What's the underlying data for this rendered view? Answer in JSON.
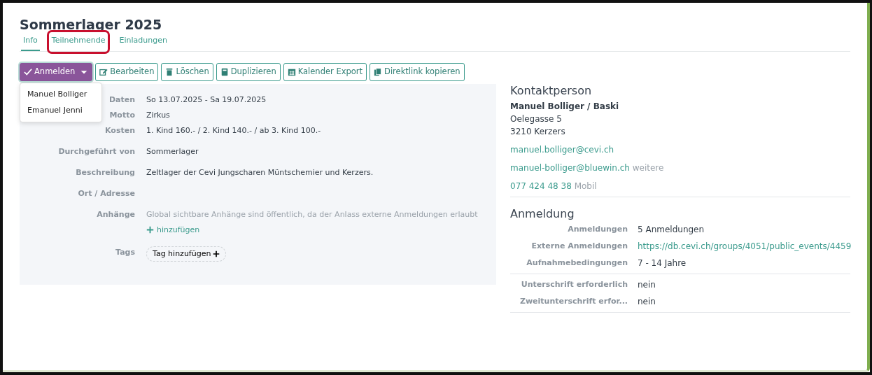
{
  "title": "Sommerlager 2025",
  "tabs": [
    {
      "label": "Info",
      "selected": true,
      "highlighted": false
    },
    {
      "label": "Teilnehmende",
      "selected": false,
      "highlighted": true
    },
    {
      "label": "Einladungen",
      "selected": false,
      "highlighted": false
    }
  ],
  "actions": [
    {
      "label": "Anmelden",
      "kind": "dropdown",
      "expanded": true,
      "menu": [
        "Manuel Bolliger",
        "Emanuel Jenni"
      ]
    },
    {
      "label": "Bearbeiten",
      "kind": "outline"
    },
    {
      "label": "Löschen",
      "kind": "outline"
    },
    {
      "label": "Duplizieren",
      "kind": "outline"
    },
    {
      "label": "Kalender Export",
      "kind": "outline"
    },
    {
      "label": "Direktlink kopieren",
      "kind": "outline"
    }
  ],
  "details": [
    {
      "label": "Daten",
      "kind": "text",
      "value": "So 13.07.2025 - Sa 19.07.2025"
    },
    {
      "label": "Motto",
      "kind": "text",
      "value": "Zirkus"
    },
    {
      "label": "Kosten",
      "kind": "text",
      "value": "1. Kind 160.- / 2. Kind 140.- / ab 3. Kind 100.-"
    },
    {
      "label": "Durchgeführt von",
      "kind": "text",
      "value": "Sommerlager"
    },
    {
      "label": "Beschreibung",
      "kind": "text",
      "value": "Zeltlager der Cevi Jungscharen Müntschemier und Kerzers."
    },
    {
      "label": "Ort / Adresse",
      "kind": "empty"
    },
    {
      "label": "Anhänge",
      "kind": "attachments",
      "note": "Global sichtbare Anhänge sind öffentlich, da der Anlass externe Anmeldungen erlaubt",
      "add": "hinzufügen"
    },
    {
      "label": "Tags",
      "kind": "tags",
      "add": "Tag hinzufügen"
    }
  ],
  "contact": {
    "heading": "Kontaktperson",
    "name": "Manuel Bolliger / Baski",
    "address": [
      "Oelegasse 5",
      "3210 Kerzers"
    ],
    "entries": [
      {
        "link": "manuel.bolliger@cevi.ch"
      },
      {
        "link": "manuel-bolliger@bluewin.ch",
        "note": "weitere"
      },
      {
        "link": "077 424 48 38",
        "note": "Mobil"
      }
    ]
  },
  "registration": {
    "heading": "Anmeldung",
    "groups": [
      [
        {
          "label": "Anmeldungen",
          "value": "5 Anmeldungen",
          "kind": "text"
        },
        {
          "label": "Externe Anmeldungen",
          "value": "https://db.cevi.ch/groups/4051/public_events/4459",
          "kind": "link"
        },
        {
          "label": "Aufnahmebedingungen",
          "value": "7 - 14 Jahre",
          "kind": "text"
        }
      ],
      [
        {
          "label": "Unterschrift erforderlich",
          "value": "nein",
          "kind": "text"
        },
        {
          "label": "Zweitunterschrift erfor...",
          "value": "nein",
          "kind": "text"
        }
      ]
    ]
  }
}
